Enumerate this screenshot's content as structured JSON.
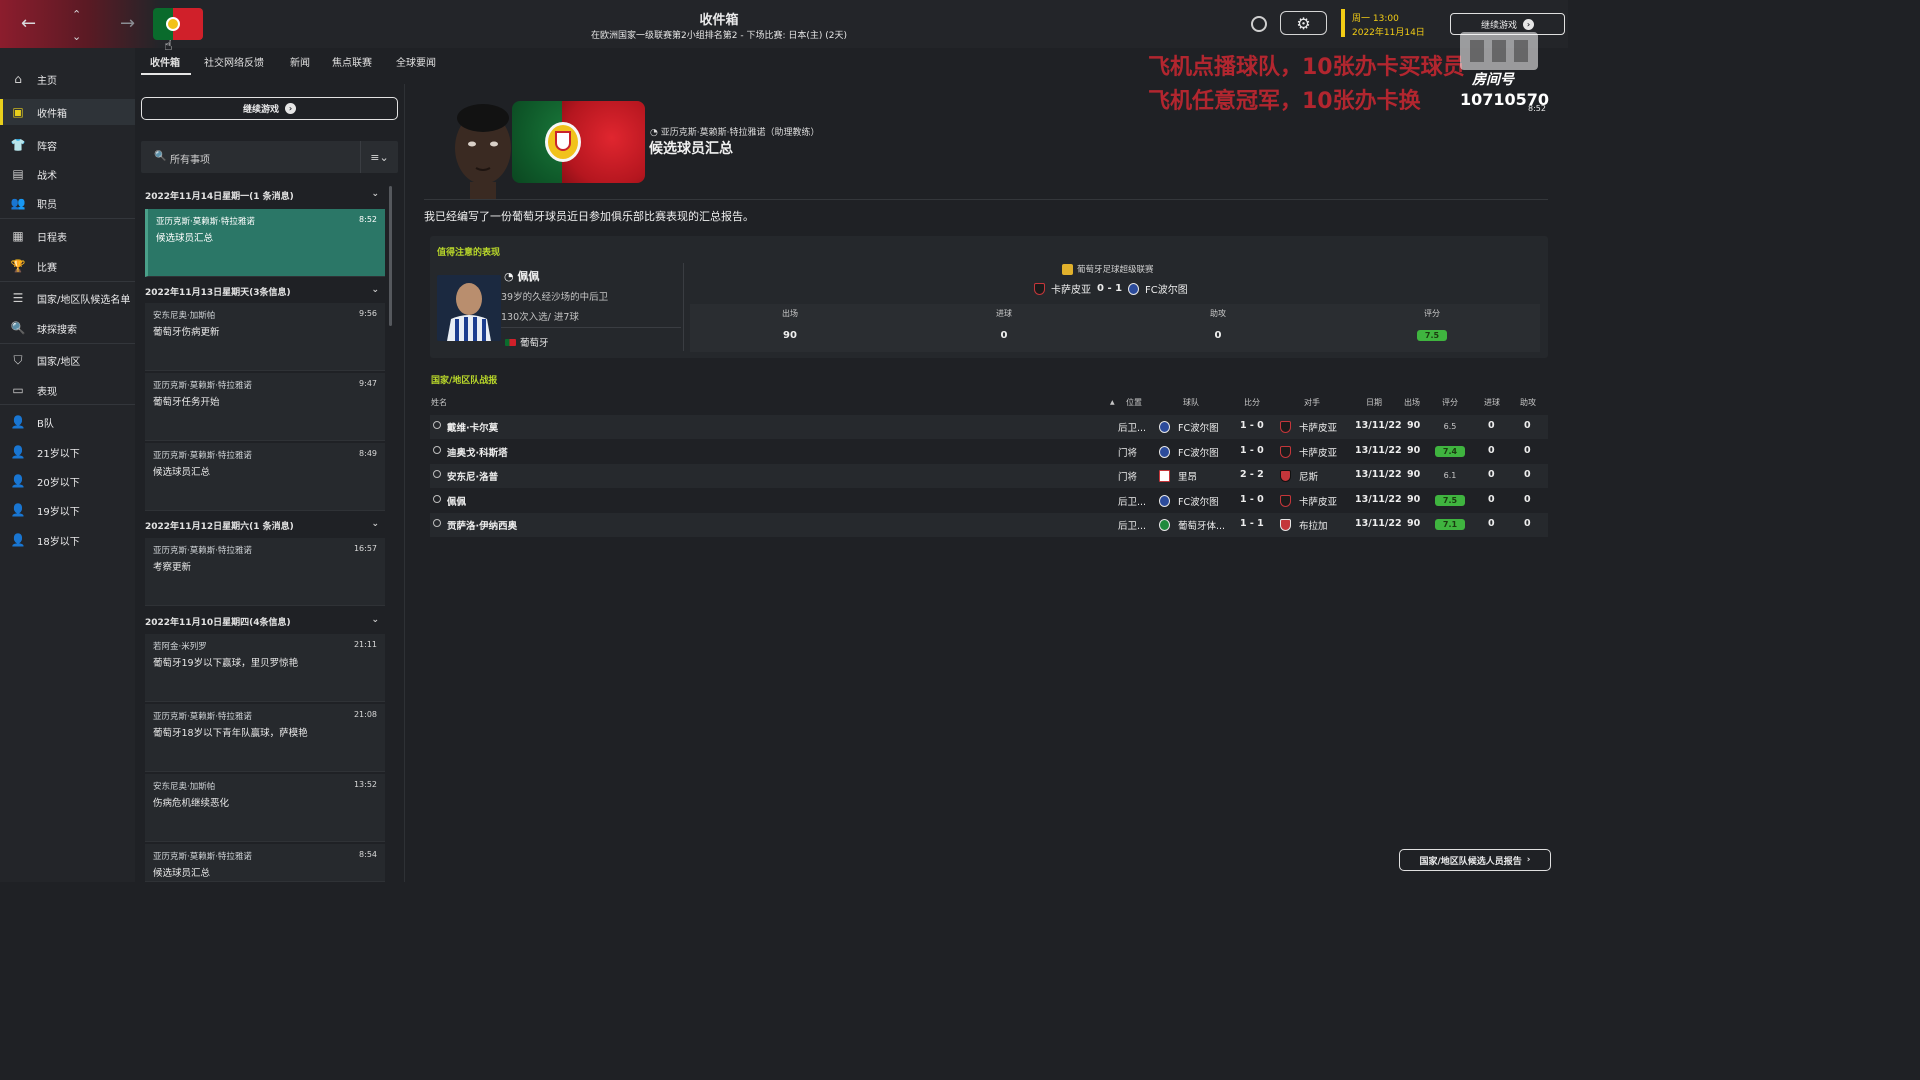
{
  "header": {
    "title": "收件箱",
    "subtitle": "在欧洲国家一级联赛第2小组排名第2 - 下场比赛: 日本(主) (2天)",
    "date_line1": "周一 13:00",
    "date_line2": "2022年11月14日",
    "continue_label": "继续游戏"
  },
  "sidebar": {
    "items": [
      {
        "label": "主页",
        "icon": "home-icon"
      },
      {
        "label": "收件箱",
        "icon": "inbox-icon",
        "active": true
      },
      {
        "label": "阵容",
        "icon": "shirt-icon"
      },
      {
        "label": "战术",
        "icon": "tactics-icon"
      },
      {
        "label": "职员",
        "icon": "staff-icon"
      },
      {
        "label": "日程表",
        "icon": "calendar-icon"
      },
      {
        "label": "比赛",
        "icon": "trophy-icon"
      },
      {
        "label": "国家/地区队候选名单",
        "icon": "list-icon"
      },
      {
        "label": "球探搜索",
        "icon": "search-icon"
      },
      {
        "label": "国家/地区",
        "icon": "shield-icon"
      },
      {
        "label": "表现",
        "icon": "performance-icon"
      },
      {
        "label": "B队",
        "icon": "team-b-icon"
      },
      {
        "label": "21岁以下",
        "icon": "u21-icon"
      },
      {
        "label": "20岁以下",
        "icon": "u20-icon"
      },
      {
        "label": "19岁以下",
        "icon": "u19-icon"
      },
      {
        "label": "18岁以下",
        "icon": "u18-icon"
      }
    ]
  },
  "tabs": [
    "收件箱",
    "社交网络反馈",
    "新闻",
    "焦点联赛",
    "全球要闻"
  ],
  "inbox": {
    "continue_label": "继续游戏",
    "filter_label": "所有事项",
    "groups": [
      {
        "date": "2022年11月14日星期一(1 条消息)",
        "messages": [
          {
            "from": "亚历克斯·莫赖斯·特拉雅诺",
            "subject": "候选球员汇总",
            "time": "8:52",
            "selected": true
          }
        ]
      },
      {
        "date": "2022年11月13日星期天(3条信息)",
        "messages": [
          {
            "from": "安东尼奥·加斯帕",
            "subject": "葡萄牙伤病更新",
            "time": "9:56"
          },
          {
            "from": "亚历克斯·莫赖斯·特拉雅诺",
            "subject": "葡萄牙任务开始",
            "time": "9:47"
          },
          {
            "from": "亚历克斯·莫赖斯·特拉雅诺",
            "subject": "候选球员汇总",
            "time": "8:49"
          }
        ]
      },
      {
        "date": "2022年11月12日星期六(1 条消息)",
        "messages": [
          {
            "from": "亚历克斯·莫赖斯·特拉雅诺",
            "subject": "考察更新",
            "time": "16:57"
          }
        ]
      },
      {
        "date": "2022年11月10日星期四(4条信息)",
        "messages": [
          {
            "from": "若阿金·米列罗",
            "subject": "葡萄牙19岁以下赢球，里贝罗惊艳",
            "time": "21:11"
          },
          {
            "from": "亚历克斯·莫赖斯·特拉雅诺",
            "subject": "葡萄牙18岁以下青年队赢球，萨模艳",
            "time": "21:08"
          },
          {
            "from": "安东尼奥·加斯帕",
            "subject": "伤病危机继续恶化",
            "time": "13:52"
          },
          {
            "from": "亚历克斯·莫赖斯·特拉雅诺",
            "subject": "候选球员汇总",
            "time": "8:54"
          }
        ]
      }
    ]
  },
  "message": {
    "sender": "亚历克斯·莫赖斯·特拉雅诺（助理教练）",
    "title": "候选球员汇总",
    "intro": "我已经编写了一份葡萄牙球员近日参加俱乐部比赛表现的汇总报告。",
    "notable": {
      "section_title": "值得注意的表现",
      "player_name": "佩佩",
      "player_desc": "39岁的久经沙场的中后卫",
      "player_caps": "130次入选/ 进7球",
      "player_nation": "葡萄牙",
      "competition": "葡萄牙足球超级联赛",
      "home": "卡萨皮亚",
      "score": "0 - 1",
      "away": "FC波尔图",
      "stats": [
        {
          "label": "出场",
          "value": "90"
        },
        {
          "label": "进球",
          "value": "0"
        },
        {
          "label": "助攻",
          "value": "0"
        },
        {
          "label": "评分",
          "value": "7.5"
        }
      ]
    },
    "national": {
      "section_title": "国家/地区队战报",
      "columns": {
        "name": "姓名",
        "pos": "位置",
        "club": "球队",
        "score": "比分",
        "opp": "对手",
        "date": "日期",
        "mins": "出场",
        "rating": "评分",
        "goals": "进球",
        "assists": "助攻"
      },
      "rows": [
        {
          "name": "戴维·卡尔莫",
          "pos": "后卫...",
          "club": "FC波尔图",
          "club_crest": "porto",
          "score": "1 - 0",
          "opp": "卡萨皮亚",
          "opp_crest": "casa",
          "date": "13/11/22",
          "mins": "90",
          "rating": "6.5",
          "rating_highlight": false,
          "goals": "0",
          "assists": "0"
        },
        {
          "name": "迪奥戈·科斯塔",
          "pos": "门将",
          "club": "FC波尔图",
          "club_crest": "porto",
          "score": "1 - 0",
          "opp": "卡萨皮亚",
          "opp_crest": "casa",
          "date": "13/11/22",
          "mins": "90",
          "rating": "7.4",
          "rating_highlight": true,
          "goals": "0",
          "assists": "0"
        },
        {
          "name": "安东尼·洛普",
          "pos": "门将",
          "club": "里昂",
          "club_crest": "lyon",
          "score": "2 - 2",
          "opp": "尼斯",
          "opp_crest": "nice",
          "date": "13/11/22",
          "mins": "90",
          "rating": "6.1",
          "rating_highlight": false,
          "goals": "0",
          "assists": "0"
        },
        {
          "name": "佩佩",
          "pos": "后卫...",
          "club": "FC波尔图",
          "club_crest": "porto",
          "score": "1 - 0",
          "opp": "卡萨皮亚",
          "opp_crest": "casa",
          "date": "13/11/22",
          "mins": "90",
          "rating": "7.5",
          "rating_highlight": true,
          "goals": "0",
          "assists": "0"
        },
        {
          "name": "贡萨洛·伊纳西奥",
          "pos": "后卫...",
          "club": "葡萄牙体...",
          "club_crest": "sporting",
          "score": "1 - 1",
          "opp": "布拉加",
          "opp_crest": "braga",
          "date": "13/11/22",
          "mins": "90",
          "rating": "7.1",
          "rating_highlight": true,
          "goals": "0",
          "assists": "0"
        }
      ]
    }
  },
  "overlay": {
    "promo1": "飞机点播球队，10张办卡买球员",
    "promo2": "飞机任意冠军，10张办卡换",
    "watermark": "房间号",
    "room_number": "10710570",
    "room_time": "8:52"
  },
  "bottom_button": "国家/地区队候选人员报告",
  "colors": {
    "accent_yellow": "#e8cf1c",
    "section_green": "#b8d62a",
    "selected_teal": "#2b7767",
    "rating_green": "#3fb43f",
    "promo_red": "#dc2832"
  }
}
